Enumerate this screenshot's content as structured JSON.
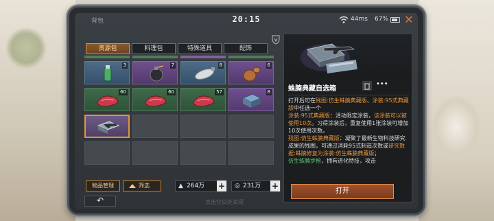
{
  "header": {
    "title": "背包",
    "time": "20:15",
    "ping": "44ms",
    "battery": "67%",
    "battery_level": 0.67
  },
  "tabs": [
    {
      "label": "资源包",
      "active": true
    },
    {
      "label": "料理包",
      "active": false
    },
    {
      "label": "特殊道具",
      "active": false
    },
    {
      "label": "配饰",
      "active": false
    }
  ],
  "grid": {
    "rows": [
      [
        {
          "item": "green-bottle",
          "rarity": "blue",
          "count": "3"
        },
        {
          "item": "bomb",
          "rarity": "purple",
          "count": "7"
        },
        {
          "item": "spray-can",
          "rarity": "blue",
          "count": "8"
        },
        {
          "item": "bottle-gourd",
          "rarity": "purple",
          "count": "6"
        }
      ],
      [
        {
          "item": "red-pod",
          "rarity": "green",
          "count": "60"
        },
        {
          "item": "red-pod",
          "rarity": "green",
          "count": "60"
        },
        {
          "item": "red-pod",
          "rarity": "green",
          "count": "57"
        },
        {
          "item": "blueprint-crate",
          "rarity": "purple",
          "count": "8"
        }
      ],
      [
        {
          "item": "selected-box",
          "rarity": "selected",
          "count": ""
        }
      ]
    ]
  },
  "bottom": {
    "manage": "物品管理",
    "filter": "筛选",
    "currency1": "264万",
    "currency2": "231万",
    "hint": "点击空白处关闭"
  },
  "detail": {
    "name": "蛛腩典藏自选箱",
    "desc": [
      {
        "t": "打开后可在",
        "c": ""
      },
      {
        "t": "残图:仿生蛛腩典藏版",
        "c": "o"
      },
      {
        "t": "、",
        "c": ""
      },
      {
        "t": "涂装:95式典藏版",
        "c": "o"
      },
      {
        "t": "中任选一个",
        "c": ""
      },
      {
        "br": true
      },
      {
        "t": "涂装:95式典藏版",
        "c": "o"
      },
      {
        "t": "：活动限定涂装，",
        "c": ""
      },
      {
        "t": "该涂装可以被使用10次",
        "c": "o"
      },
      {
        "t": "。习得涂装后，重复使用1张涂装可增加10次使用次数。",
        "c": ""
      },
      {
        "br": true
      },
      {
        "t": "残图:仿生蛛腩典藏版",
        "c": "o"
      },
      {
        "t": "：凝聚了最新生物科技研究成果的残图，可通过消耗95式制造次数或",
        "c": ""
      },
      {
        "t": "研究数据:蛛腩修复为",
        "c": "o"
      },
      {
        "t": "涂装:仿生蛛腩典藏版",
        "c": "o"
      },
      {
        "t": "；",
        "c": ""
      },
      {
        "br": true
      },
      {
        "t": "仿生蛛腩步枪",
        "c": "g"
      },
      {
        "t": "，拥有进化特技，攻击",
        "c": ""
      }
    ],
    "open_label": "打开"
  },
  "colors": {
    "accent": "#e1953c",
    "close": "#e0792f",
    "rarity_blue": "#4d6c88",
    "rarity_purple": "#6f4f8e",
    "rarity_green": "#3f6b4a"
  }
}
